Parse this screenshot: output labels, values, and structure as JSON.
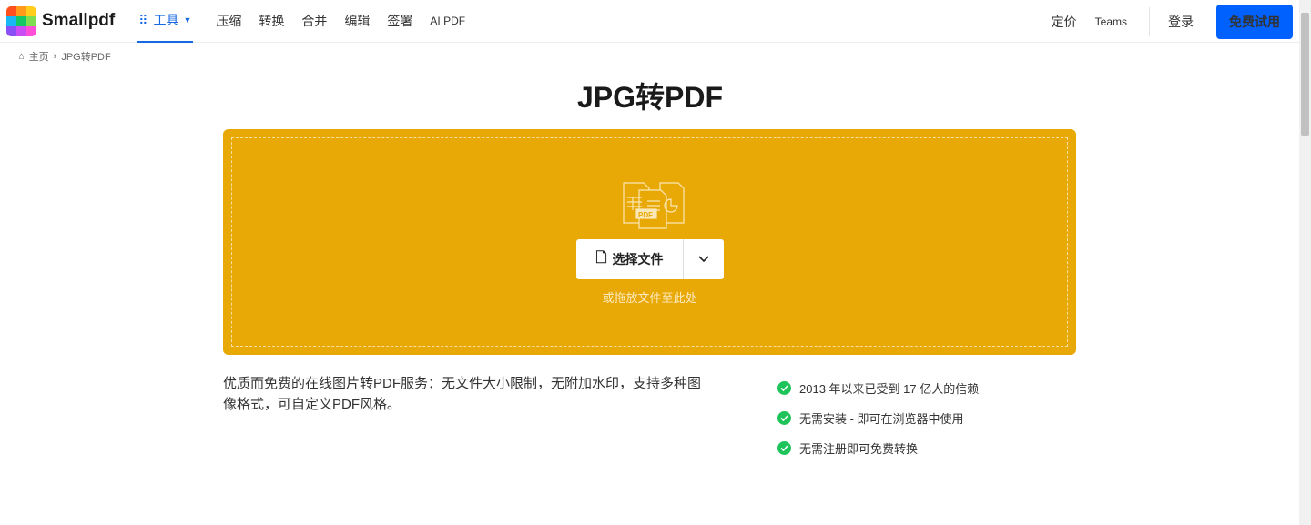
{
  "header": {
    "brand": "Smallpdf",
    "nav": [
      {
        "label": "工具",
        "active": true
      },
      {
        "label": "压缩"
      },
      {
        "label": "转换"
      },
      {
        "label": "合并"
      },
      {
        "label": "编辑"
      },
      {
        "label": "签署"
      },
      {
        "label": "AI PDF"
      }
    ],
    "pricing": "定价",
    "teams": "Teams",
    "login": "登录",
    "trial": "免费试用"
  },
  "breadcrumb": {
    "home": "主页",
    "current": "JPG转PDF"
  },
  "title": "JPG转PDF",
  "dropzone": {
    "choose": "选择文件",
    "hint": "或拖放文件至此处",
    "icon_label": "PDF",
    "color": "#e8a805"
  },
  "description": "优质而免费的在线图片转PDF服务：无文件大小限制，无附加水印，支持多种图像格式，可自定义PDF风格。",
  "features": [
    "2013 年以来已受到 17 亿人的信赖",
    "无需安装 - 即可在浏览器中使用",
    "无需注册即可免费转换"
  ]
}
